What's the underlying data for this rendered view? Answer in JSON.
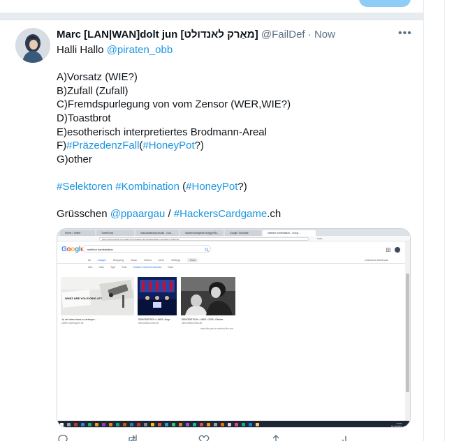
{
  "tweet": {
    "display_name": "Marc [LAN|WAN]dolt jun [מאַרק לאנדולט]",
    "handle": "@FailDef",
    "separator": "·",
    "time": "Now",
    "more_label": "•••",
    "lines": [
      {
        "parts": [
          {
            "t": "Halli Hallo "
          },
          {
            "t": "@piraten_obb",
            "link": true
          }
        ]
      },
      {
        "blank": true
      },
      {
        "parts": [
          {
            "t": "A)Vorsatz (WIE?)"
          }
        ]
      },
      {
        "parts": [
          {
            "t": "B)Zufall (Zufall)"
          }
        ]
      },
      {
        "parts": [
          {
            "t": "C)Fremdspurlegung von vom Zensor (WER,WIE?)"
          }
        ]
      },
      {
        "parts": [
          {
            "t": "D)Toastbrot"
          }
        ]
      },
      {
        "parts": [
          {
            "t": "E)esotherisch interpretiertes Brodmann-Areal"
          }
        ]
      },
      {
        "parts": [
          {
            "t": "F)"
          },
          {
            "t": "#PräzedenzFall",
            "link": true
          },
          {
            "t": "("
          },
          {
            "t": "#HoneyPot",
            "link": true
          },
          {
            "t": "?)"
          }
        ]
      },
      {
        "parts": [
          {
            "t": "G)other"
          }
        ]
      },
      {
        "blank": true
      },
      {
        "parts": [
          {
            "t": "#Selektoren",
            "link": true
          },
          {
            "t": " "
          },
          {
            "t": "#Kombination",
            "link": true
          },
          {
            "t": " ("
          },
          {
            "t": "#HoneyPot",
            "link": true
          },
          {
            "t": "?)"
          }
        ]
      },
      {
        "blank": true
      },
      {
        "parts": [
          {
            "t": "Grüsschen "
          },
          {
            "t": "@ppaargau",
            "link": true
          },
          {
            "t": " / "
          },
          {
            "t": "#HackersCardgame",
            "link": true
          },
          {
            "t": ".ch"
          }
        ]
      }
    ]
  },
  "screenshot": {
    "tabs": [
      "Home / Twitter",
      "TweetDeck",
      "radioandstumpcloudio - Goo...",
      "hackerscardgame.ch/pgp/99c...",
      "Google Translate",
      "selektor kombination - Goog..."
    ],
    "url": "https://www.google.com/search?q=selektor+kombination&tbm=isch&tbs=il:cl&hl=de",
    "zoom": "110%",
    "logo_letters": [
      {
        "ch": "G",
        "color": "#4285f4"
      },
      {
        "ch": "o",
        "color": "#ea4335"
      },
      {
        "ch": "o",
        "color": "#fbbc05"
      },
      {
        "ch": "g",
        "color": "#4285f4"
      },
      {
        "ch": "l",
        "color": "#34a853"
      },
      {
        "ch": "e",
        "color": "#ea4335"
      }
    ],
    "query": "selektor kombination",
    "nav": [
      "All",
      "Images",
      "Shopping",
      "News",
      "Videos",
      "More",
      "Settings",
      "Tools"
    ],
    "filters": [
      "Size",
      "Color",
      "Type",
      "Time",
      "Creative Commons licenses",
      "Clear"
    ],
    "right_links": "Collections   SafeSearch",
    "results": [
      {
        "caption": "Ja, wir haben etwas zu verbergen ...",
        "source": "piraten-oberbayern.de"
      },
      {
        "caption": "DEMORATISCH • LINKS • Begr...",
        "source": "demoratisch-links.de"
      },
      {
        "caption": "DEMORATISCH • LINKS • 2018 • Oktober",
        "source": "demoratisch-links.de"
      }
    ],
    "sign_text": "WHAT ARE YOU DOING AT?",
    "end_text": "Looks like you've reached the end",
    "clock_time": "17:20",
    "clock_date": "01.10.2019"
  }
}
